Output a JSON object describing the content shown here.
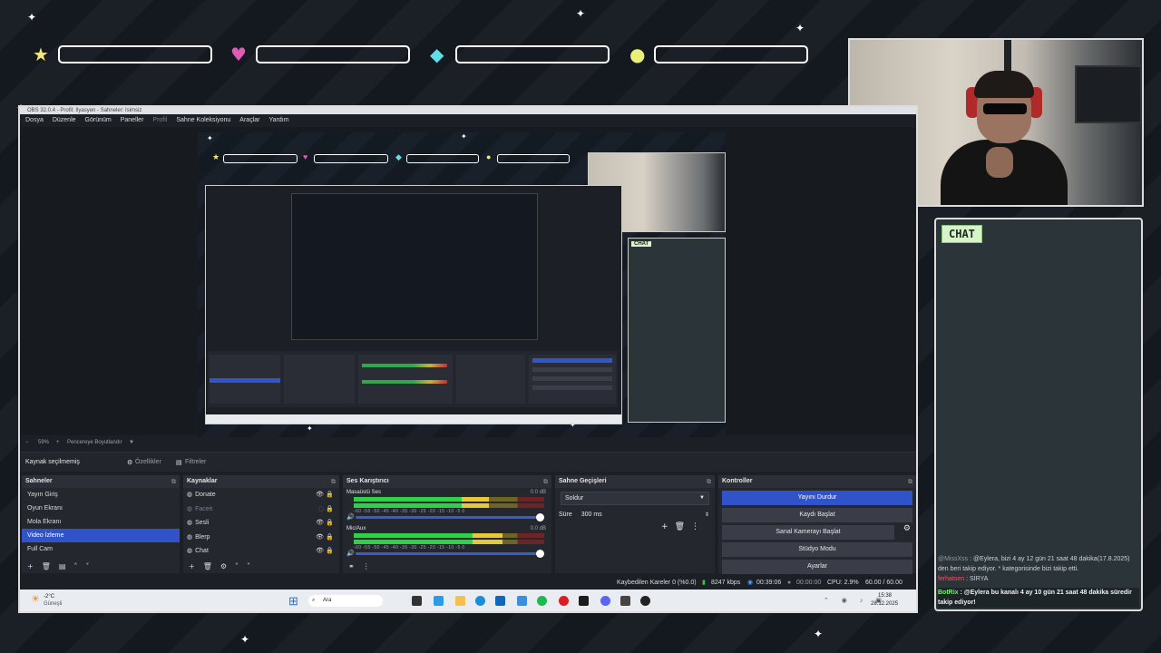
{
  "obs": {
    "title": "OBS 32.0.4 - Profil: Ilyasyen - Sahneler: Isimsiz",
    "menu": [
      "Dosya",
      "Düzenle",
      "Görünüm",
      "Paneller",
      "Profil",
      "Sahne Koleksiyonu",
      "Araçlar",
      "Yardım"
    ],
    "zoom": "59%",
    "fit_label": "Pencereye Boyutlandır",
    "source_status": "Kaynak seçilmemiş",
    "properties_label": "Özellikler",
    "filters_label": "Filtreler"
  },
  "scenes": {
    "header": "Sahneler",
    "items": [
      "Yayın Giriş",
      "Oyun Ekranı",
      "Mola Ekranı",
      "Video İzleme",
      "Full Cam"
    ],
    "selected_index": 3
  },
  "sources": {
    "header": "Kaynaklar",
    "items": [
      {
        "label": "Donate",
        "visible": true,
        "icon": "globe-icon"
      },
      {
        "label": "Faceit",
        "visible": false,
        "icon": "globe-icon"
      },
      {
        "label": "Sesli",
        "visible": true,
        "icon": "globe-icon"
      },
      {
        "label": "Blerp",
        "visible": true,
        "icon": "globe-icon"
      },
      {
        "label": "Chat",
        "visible": true,
        "icon": "globe-icon"
      }
    ]
  },
  "mixer": {
    "header": "Ses Karıştırıcı",
    "channels": [
      {
        "name": "Masaüstü Ses",
        "db": "0.0 dB",
        "level": 0.71
      },
      {
        "name": "Mic/Aux",
        "db": "0.0 dB",
        "level": 0.78
      }
    ],
    "scale": "-60  -55  -50  -45  -40  -35  -30  -25  -20  -15  -10  -5  0"
  },
  "transitions": {
    "header": "Sahne Geçişleri",
    "selected": "Soldur",
    "duration_label": "Süre",
    "duration_value": "300 ms"
  },
  "controls": {
    "header": "Kontroller",
    "stop_stream": "Yayını Durdur",
    "start_recording": "Kaydı Başlat",
    "virtual_camera": "Sanal Kamerayı Başlat",
    "studio_mode": "Stüdyo Modu",
    "settings": "Ayarlar"
  },
  "status": {
    "dropped_frames": "Kaybedilen Kareler 0 (%0.0)",
    "bitrate": "8247 kbps",
    "stream_time": "00:39:06",
    "rec_time": "00:00:00",
    "cpu": "CPU: 2.9%",
    "fps": "60.00 / 60.00 FPS"
  },
  "taskbar": {
    "weather_temp": "-2°C",
    "weather_desc": "Güneşli",
    "search": "Ara",
    "time": "15:38",
    "date": "28.12.2025"
  },
  "chat": {
    "tag": "CHAT",
    "messages": [
      {
        "user": "@MissXss",
        "text": ": @Eylera, bizi 4 ay 12 gün 21 saat 48 dakika(17.8.2025) den beri takip ediyor. * kategorisinde bizi takip etti."
      },
      {
        "user": "ferhatsen",
        "text": ": SİRYA"
      },
      {
        "user": "BotRix",
        "text": ": @Eylera bu kanalı 4 ay 10 gün 21 saat 48 dakika süredir takip ediyor!"
      }
    ]
  },
  "colors": {
    "accent": "#3153c9",
    "chat_tag_bg": "#d7f3c9",
    "star": "#f3e77a",
    "heart": "#e05bb8",
    "diamond": "#5fe0e8",
    "coin": "#e8f07a"
  }
}
